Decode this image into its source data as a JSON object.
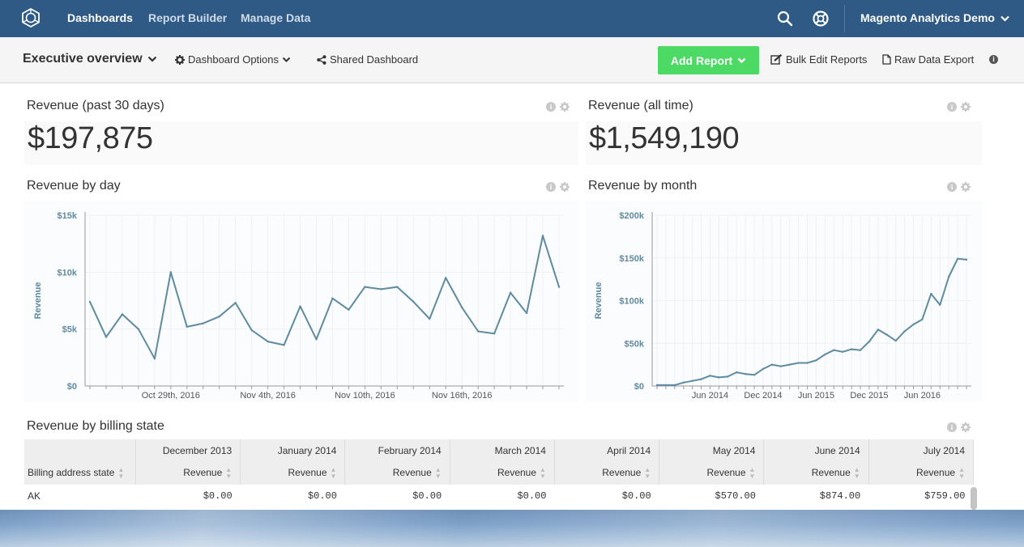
{
  "nav": {
    "links": [
      "Dashboards",
      "Report Builder",
      "Manage Data"
    ],
    "account": "Magento Analytics Demo",
    "icons": [
      "logo-icon",
      "search-icon",
      "help-icon",
      "chevron-down-icon"
    ]
  },
  "toolbar": {
    "dashboard_title": "Executive overview",
    "dashboard_options": "Dashboard Options",
    "shared_dashboard": "Shared Dashboard",
    "add_report": "Add Report",
    "bulk_edit": "Bulk Edit Reports",
    "raw_export": "Raw Data Export",
    "accent_color": "#4cd964"
  },
  "cards": {
    "revenue_30": {
      "title": "Revenue (past 30 days)",
      "value": "$197,875"
    },
    "revenue_all": {
      "title": "Revenue (all time)",
      "value": "$1,549,190"
    },
    "revenue_day": {
      "title": "Revenue by day"
    },
    "revenue_month": {
      "title": "Revenue by month"
    },
    "billing": {
      "title": "Revenue by billing state"
    }
  },
  "chart_data": [
    {
      "type": "line",
      "ylabel": "Revenue",
      "ylim": [
        0,
        15000
      ],
      "y_ticks": [
        "$0",
        "$5k",
        "$10k",
        "$15k"
      ],
      "x_ticks": [
        "Oct 29th, 2016",
        "Nov 4th, 2016",
        "Nov 10th, 2016",
        "Nov 16th, 2016"
      ],
      "x_tick_positions": [
        5,
        11,
        17,
        23
      ],
      "color": "#5f8ba0",
      "values": [
        7400,
        4300,
        6300,
        5000,
        2400,
        10000,
        5200,
        5500,
        6100,
        7300,
        4900,
        3900,
        3600,
        7000,
        4100,
        7700,
        6700,
        8700,
        8500,
        8700,
        7400,
        5900,
        9500,
        6900,
        4800,
        4600,
        8200,
        6400,
        13200,
        8700
      ]
    },
    {
      "type": "line",
      "ylabel": "Revenue",
      "ylim": [
        0,
        200000
      ],
      "y_ticks": [
        "$0",
        "$50k",
        "$100k",
        "$150k",
        "$200k"
      ],
      "x_ticks": [
        "Jun 2014",
        "Dec 2014",
        "Jun 2015",
        "Dec 2015",
        "Jun 2016"
      ],
      "x_tick_positions": [
        6,
        12,
        18,
        24,
        30
      ],
      "color": "#5f8ba0",
      "values": [
        1000,
        1000,
        1000,
        4000,
        6000,
        8000,
        12000,
        10000,
        11000,
        16000,
        14000,
        13000,
        20000,
        25000,
        23000,
        25000,
        27000,
        27000,
        30000,
        37000,
        42000,
        40000,
        43000,
        42000,
        52000,
        66000,
        60000,
        53000,
        64000,
        72000,
        78000,
        108000,
        95000,
        128000,
        149000,
        148000
      ]
    }
  ],
  "table": {
    "first_header": "Billing address state",
    "months": [
      "December 2013",
      "January 2014",
      "February 2014",
      "March 2014",
      "April 2014",
      "May 2014",
      "June 2014",
      "July 2014"
    ],
    "metric_label": "Revenue",
    "rows": [
      {
        "state": "AK",
        "values": [
          "$0.00",
          "$0.00",
          "$0.00",
          "$0.00",
          "$0.00",
          "$570.00",
          "$874.00",
          "$759.00"
        ]
      }
    ]
  }
}
